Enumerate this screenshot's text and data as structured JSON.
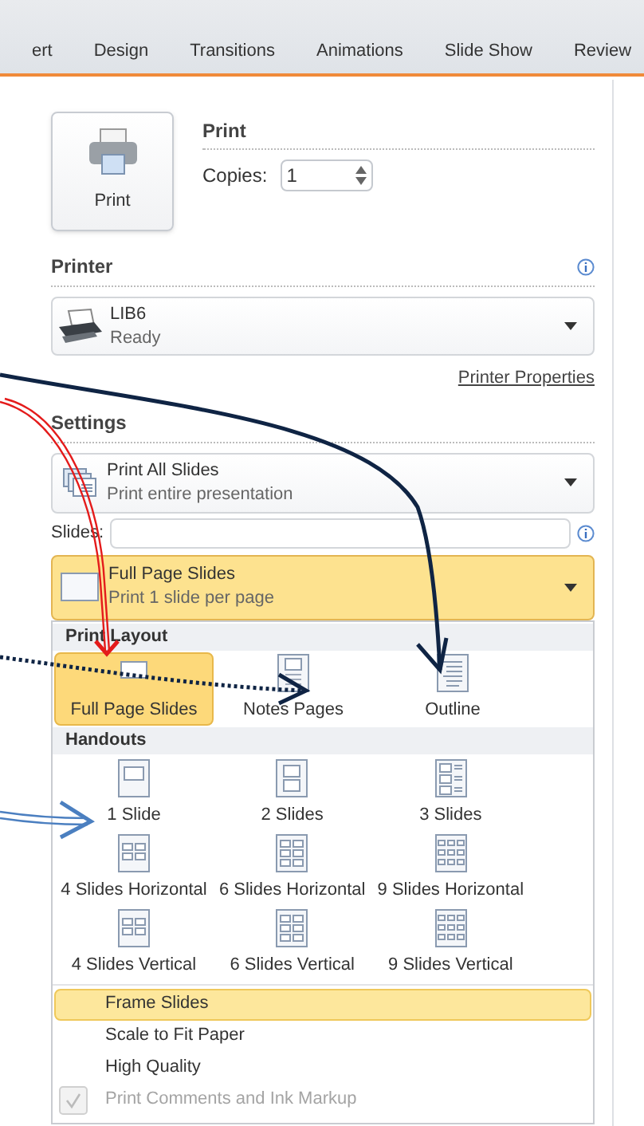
{
  "ribbon_tabs": [
    {
      "label": "ert",
      "selected": false
    },
    {
      "label": "Design",
      "selected": false
    },
    {
      "label": "Transitions",
      "selected": false
    },
    {
      "label": "Animations",
      "selected": false
    },
    {
      "label": "Slide Show",
      "selected": false
    },
    {
      "label": "Review",
      "selected": false
    }
  ],
  "print": {
    "button": "Print",
    "heading": "Print",
    "copies_label": "Copies:",
    "copies_value": "1"
  },
  "printer": {
    "heading": "Printer",
    "name": "LIB6",
    "status": "Ready",
    "properties_link": "Printer Properties"
  },
  "settings": {
    "heading": "Settings",
    "range": {
      "title": "Print All Slides",
      "subtitle": "Print entire presentation"
    },
    "slides_label": "Slides:",
    "layout": {
      "title": "Full Page Slides",
      "subtitle": "Print 1 slide per page",
      "expanded": true
    }
  },
  "layout_menu": {
    "print_layout_heading": "Print Layout",
    "print_layouts": [
      {
        "label": "Full Page Slides",
        "kind": "full",
        "selected": true
      },
      {
        "label": "Notes Pages",
        "kind": "notes",
        "selected": false
      },
      {
        "label": "Outline",
        "kind": "outline",
        "selected": false
      }
    ],
    "handouts_heading": "Handouts",
    "handouts": [
      {
        "label": "1 Slide",
        "kind": "h1",
        "selected": false
      },
      {
        "label": "2 Slides",
        "kind": "h2",
        "selected": false
      },
      {
        "label": "3 Slides",
        "kind": "h3",
        "selected": false
      },
      {
        "label": "4 Slides Horizontal",
        "kind": "h4",
        "selected": false
      },
      {
        "label": "6 Slides Horizontal",
        "kind": "h6",
        "selected": false
      },
      {
        "label": "9 Slides Horizontal",
        "kind": "h9",
        "selected": false
      },
      {
        "label": "4 Slides Vertical",
        "kind": "h4",
        "selected": false
      },
      {
        "label": "6 Slides Vertical",
        "kind": "h6",
        "selected": false
      },
      {
        "label": "9 Slides Vertical",
        "kind": "h9",
        "selected": false
      }
    ],
    "options": [
      {
        "label": "Frame Slides",
        "highlighted": true,
        "checked": false,
        "disabled": false
      },
      {
        "label": "Scale to Fit Paper",
        "highlighted": false,
        "checked": false,
        "disabled": false
      },
      {
        "label": "High Quality",
        "highlighted": false,
        "checked": false,
        "disabled": false
      },
      {
        "label": "Print Comments and Ink Markup",
        "highlighted": false,
        "checked": true,
        "disabled": true
      }
    ]
  }
}
